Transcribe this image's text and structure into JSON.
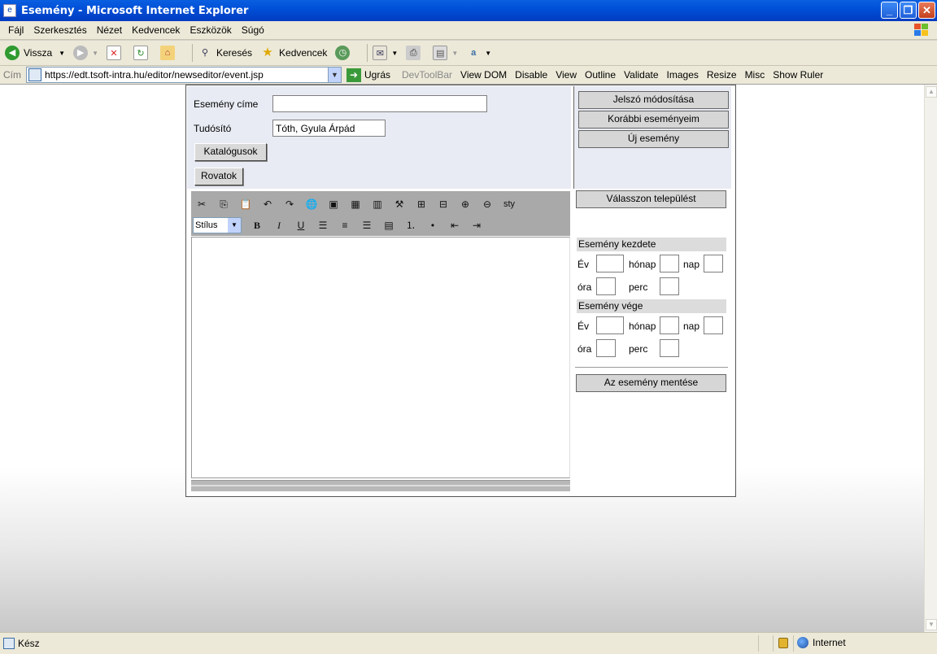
{
  "window": {
    "title": "Esemény - Microsoft Internet Explorer",
    "minimize": "_",
    "maximize": "❐",
    "close": "✕"
  },
  "menu": [
    "Fájl",
    "Szerkesztés",
    "Nézet",
    "Kedvencek",
    "Eszközök",
    "Súgó"
  ],
  "toolbar": {
    "back": "Vissza",
    "search": "Keresés",
    "favorites": "Kedvencek"
  },
  "address": {
    "label": "Cím",
    "url": "https://edt.tsoft-intra.hu/editor/newseditor/event.jsp",
    "go": "Ugrás"
  },
  "devtoolbar": [
    "DevToolBar",
    "View DOM",
    "Disable",
    "View",
    "Outline",
    "Validate",
    "Images",
    "Resize",
    "Misc",
    "Show Ruler"
  ],
  "form": {
    "title_label": "Esemény címe",
    "title_value": "",
    "reporter_label": "Tudósító",
    "reporter_value": "Tóth, Gyula Árpád",
    "catalogs_button": "Katalógusok",
    "columns_button": "Rovatok"
  },
  "right": {
    "password_button": "Jelszó módosítása",
    "previous_events_button": "Korábbi eseményeim",
    "new_event_button": "Új esemény",
    "choose_town_button": "Válasszon települést",
    "start_header": "Esemény kezdete",
    "end_header": "Esemény vége",
    "year": "Év",
    "month": "hónap",
    "day": "nap",
    "hour": "óra",
    "minute": "perc",
    "save_button": "Az esemény mentése"
  },
  "editor": {
    "style_select": "Stílus",
    "sty_label": "sty"
  },
  "status": {
    "text": "Kész",
    "zone": "Internet"
  }
}
